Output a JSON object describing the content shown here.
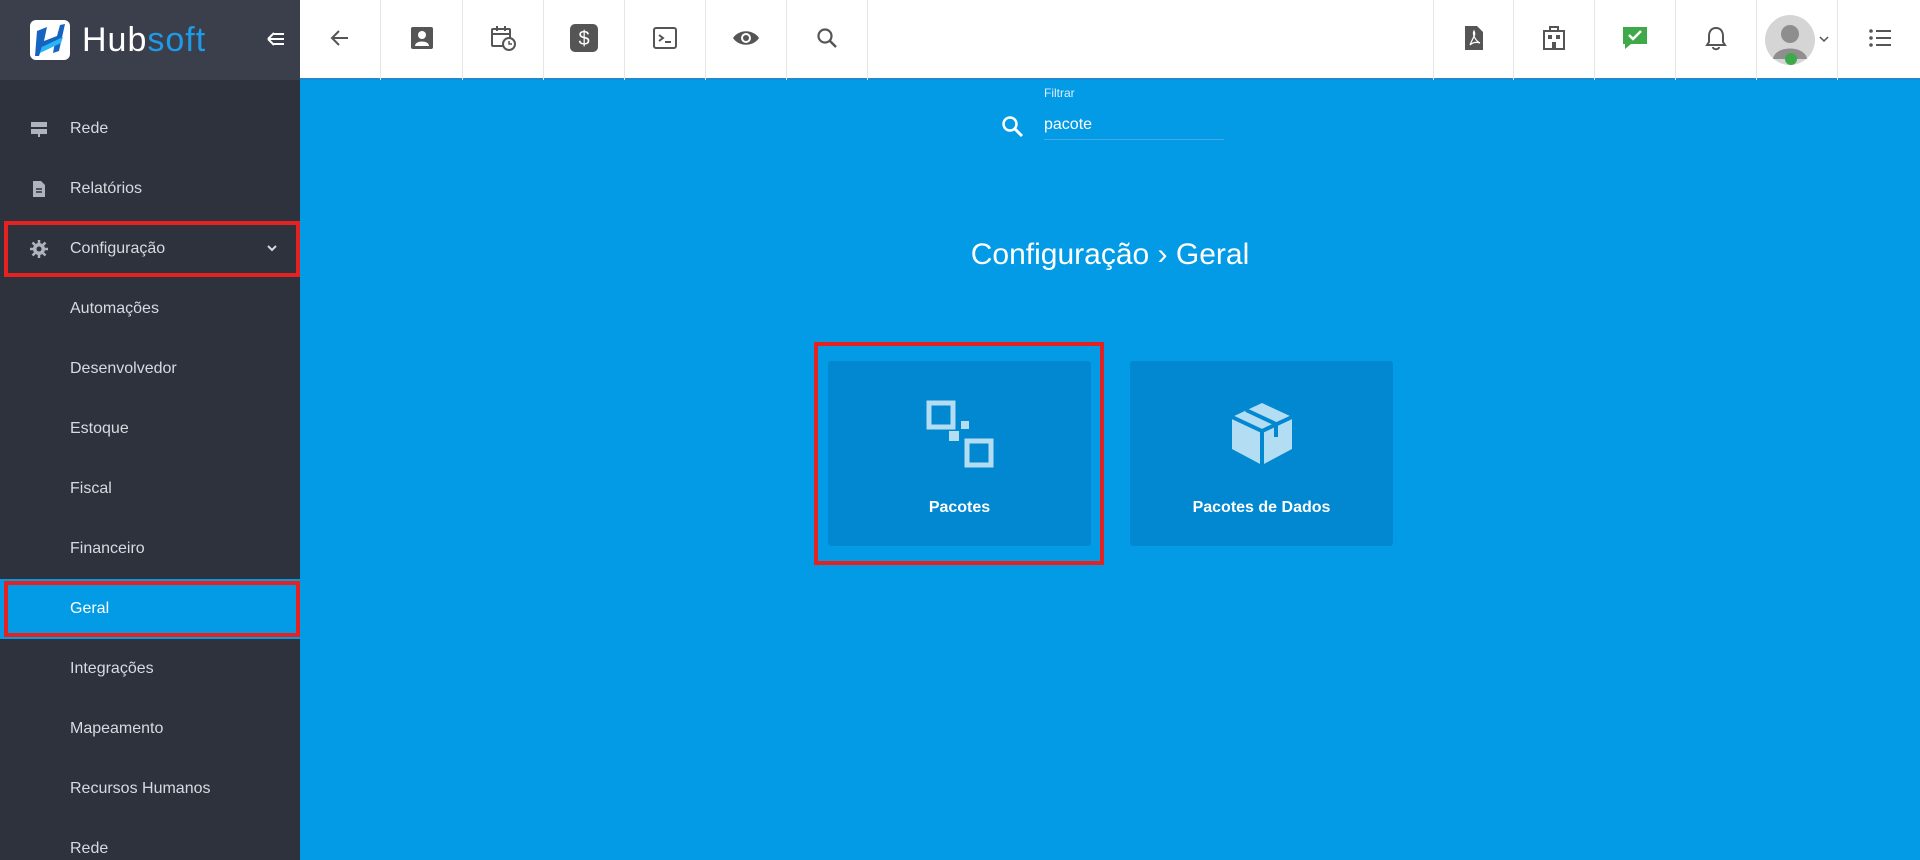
{
  "brand": {
    "name_part1": "Hub",
    "name_part2": "soft",
    "accent": "#039BE5",
    "sidebar_bg": "#2E323D",
    "highlight": "#E52222"
  },
  "sidebar": {
    "items": [
      {
        "label": "Rede",
        "icon": "server-icon"
      },
      {
        "label": "Relatórios",
        "icon": "document-icon"
      },
      {
        "label": "Configuração",
        "icon": "gear-icon",
        "expanded": true
      },
      {
        "label": "Automações"
      },
      {
        "label": "Desenvolvedor"
      },
      {
        "label": "Estoque"
      },
      {
        "label": "Fiscal"
      },
      {
        "label": "Financeiro"
      },
      {
        "label": "Geral",
        "active": true
      },
      {
        "label": "Integrações"
      },
      {
        "label": "Mapeamento"
      },
      {
        "label": "Recursos Humanos"
      },
      {
        "label": "Rede"
      }
    ]
  },
  "topbar": {
    "left_icons": [
      "back-arrow-icon",
      "contact-card-icon",
      "calendar-clock-icon",
      "dollar-icon",
      "terminal-icon",
      "eye-icon",
      "search-icon"
    ],
    "right_icons": [
      "pdf-icon",
      "building-icon",
      "chat-check-icon",
      "bell-icon",
      "avatar",
      "list-menu-icon"
    ]
  },
  "filter": {
    "label": "Filtrar",
    "value": "pacote"
  },
  "page": {
    "breadcrumb": "Configuração › Geral",
    "cards": [
      {
        "label": "Pacotes",
        "icon": "squares-icon"
      },
      {
        "label": "Pacotes de Dados",
        "icon": "box-icon"
      }
    ]
  }
}
